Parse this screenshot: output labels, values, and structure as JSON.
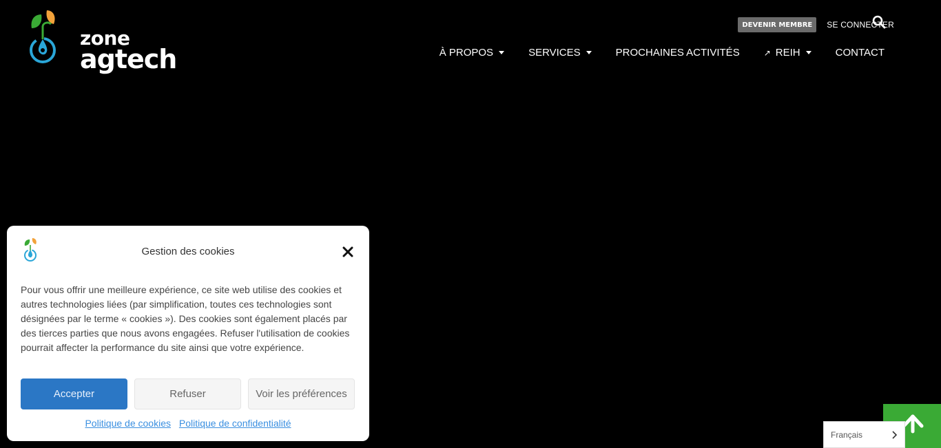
{
  "header": {
    "logo": {
      "line1": "zone",
      "line2": "agtech",
      "icon": "sprout-drop-icon"
    },
    "member_button": "DEVENIR MEMBRE",
    "login_link": "SE CONNECTER",
    "search_icon": "search-icon",
    "nav": [
      {
        "label": "À PROPOS",
        "dropdown": true
      },
      {
        "label": "SERVICES",
        "dropdown": true
      },
      {
        "label": "PROCHAINES ACTIVITÉS",
        "dropdown": false
      },
      {
        "label": "REIH",
        "dropdown": true,
        "external": true,
        "prefix": "↗"
      },
      {
        "label": "CONTACT",
        "dropdown": false
      }
    ]
  },
  "cookie": {
    "title": "Gestion des cookies",
    "body": "Pour vous offrir une meilleure expérience, ce site web utilise des cookies et autres technologies liées (par simplification, toutes ces technologies sont désignées par le terme « cookies »). Des cookies sont également placés par des tierces parties que nous avons engagées. Refuser l'utilisation de cookies pourrait affecter la performance du site ainsi que votre expérience.",
    "accept": "Accepter",
    "refuse": "Refuser",
    "preferences": "Voir les préférences",
    "link_cookies": "Politique de cookies",
    "link_privacy": "Politique de confidentialité"
  },
  "language": {
    "selected": "Français"
  },
  "colors": {
    "background": "#000000",
    "accent_green": "#3aaa35",
    "accept_blue": "#2b77c5",
    "link_blue": "#3a8fe0",
    "member_button_bg": "#6b6b6b"
  }
}
